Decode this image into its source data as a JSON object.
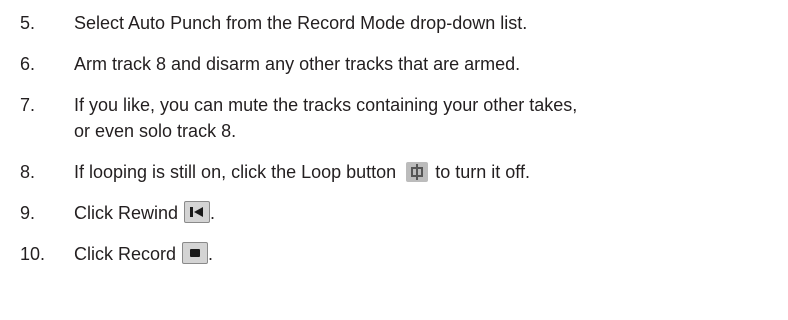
{
  "steps": [
    {
      "number": "5.",
      "text": "Select Auto Punch from the Record Mode drop-down list."
    },
    {
      "number": "6.",
      "text": "Arm track 8 and disarm any other tracks that are armed."
    },
    {
      "number": "7.",
      "line1": "If you like, you can mute the tracks containing your other takes,",
      "line2": "or even solo track 8."
    },
    {
      "number": "8.",
      "before": "If looping is still on, click the Loop button",
      "after": "to turn it off.",
      "icon": "loop-button-icon"
    },
    {
      "number": "9.",
      "before": "Click Rewind",
      "after": ".",
      "icon": "rewind-button-icon"
    },
    {
      "number": "10.",
      "before": "Click Record",
      "after": ".",
      "icon": "record-button-icon"
    }
  ]
}
